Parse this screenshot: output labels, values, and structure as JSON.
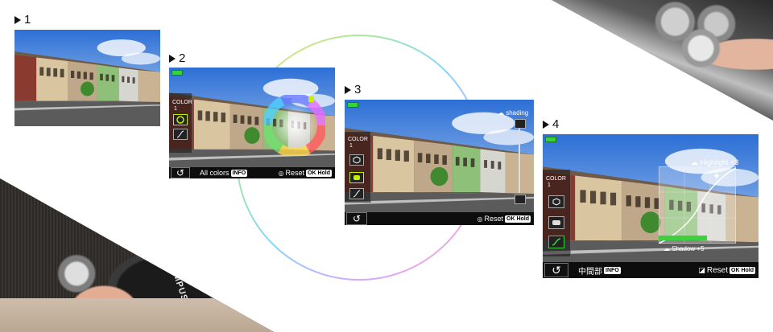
{
  "steps": [
    {
      "number": "1"
    },
    {
      "number": "2",
      "ui": {
        "color_label": "COLOR",
        "color_value": "1",
        "bottom_text": "All colors",
        "info_tag": "INFO",
        "reset_text": "Reset",
        "ok_tag": "OK Hold"
      }
    },
    {
      "number": "3",
      "ui": {
        "shading_label": "shading",
        "color_label": "COLOR",
        "color_value": "1",
        "reset_text": "Reset",
        "ok_tag": "OK Hold"
      }
    },
    {
      "number": "4",
      "ui": {
        "highlight_label": "Highlight",
        "highlight_value": "+3",
        "shadow_label": "Shadow",
        "shadow_value": "+5",
        "color_label": "COLOR",
        "color_value": "1",
        "bottom_text": "中間部",
        "info_tag": "INFO",
        "reset_text": "Reset",
        "ok_tag": "OK Hold"
      }
    }
  ],
  "camera_bottom": {
    "brand_text": "OLYMPUS"
  },
  "icons": {
    "back": "return-arrow-icon",
    "battery": "battery-icon",
    "color_wheel": "color-wheel-icon",
    "tone_curve": "tone-curve-icon",
    "shading": "shading-icon"
  },
  "colors": {
    "battery_green": "#35d53a",
    "wheel_marker": "#c4f000",
    "curve_green": "#3ecf3e"
  }
}
